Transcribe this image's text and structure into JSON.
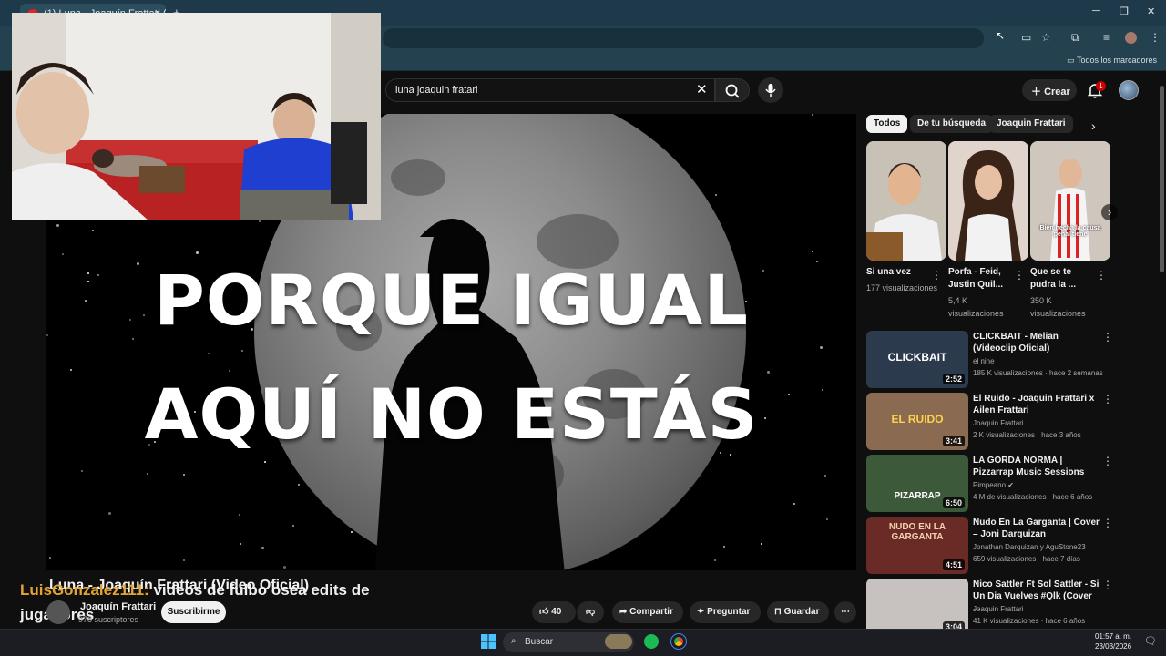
{
  "browser": {
    "tab_title": "(1) Luna - Joaquín Frattari (Vid",
    "tab_close": "×",
    "new_tab": "+",
    "bookmarks_label": "Todos los marcadores"
  },
  "masthead": {
    "search_query": "luna joaquin fratari",
    "create_label": "Crear",
    "notification_count": "1"
  },
  "player": {
    "lyric_line1": "PORQUE IGUAL",
    "lyric_line2": "AQUÍ NO ESTÁS"
  },
  "video": {
    "title": "Luna - Joaquín Frattari (Video Oficial)",
    "channel_name": "Joaquín Frattari",
    "subscribers": "978 suscriptores",
    "subscribe_label": "Suscribirme",
    "like_count": "40",
    "share_label": "Compartir",
    "ask_label": "Preguntar",
    "save_label": "Guardar"
  },
  "overlay_chat": {
    "user": "LuisGonzalez111:",
    "message": " videos de fulbo osea edits de jugadores"
  },
  "chips": [
    {
      "label": "Todos"
    },
    {
      "label": "De tu búsqueda"
    },
    {
      "label": "Joaquin Frattari"
    }
  ],
  "shorts": [
    {
      "title": "Si una vez",
      "views": "177 visualizaciones",
      "bg": "#c9b8a6"
    },
    {
      "title": "Porfa - Feid, Justin Quil...",
      "views": "5,4 K visualizaciones",
      "bg": "#d9c7be"
    },
    {
      "title": "Que se te pudra la ...",
      "views": "350 K visualizaciones",
      "bg": "#b3a8a0",
      "caption": "Bien hecha la causa penal tiene"
    }
  ],
  "related": [
    {
      "title": "CLICKBAIT - Melian (Videoclip Oficial)",
      "channel": "el nine",
      "meta": "185 K visualizaciones · hace 2 semanas",
      "duration": "2:52",
      "thumb_text": "CLICKBAIT",
      "bg": "#2b3a4c"
    },
    {
      "title": "El Ruido - Joaquin Frattari x Ailen Frattari",
      "channel": "Joaquin Frattari",
      "meta": "2 K visualizaciones · hace 3 años",
      "duration": "3:41",
      "thumb_text": "EL RUIDO",
      "bg": "#8a6b52"
    },
    {
      "title": "LA GORDA NORMA | Pizzarrap Music Sessions",
      "channel": "Pimpeano",
      "meta": "4 M de visualizaciones · hace 6 años",
      "duration": "6:50",
      "thumb_text": "PIZARRAP",
      "bg": "#3c5a3a"
    },
    {
      "title": "Nudo En La Garganta | Cover – Joni Darquizan",
      "channel": "Jonathan Darquizan y AguStone23",
      "meta": "659 visualizaciones · hace 7 días",
      "duration": "4:51",
      "thumb_text": "NUDO EN LA GARGANTA",
      "bg": "#6a2a26"
    },
    {
      "title": "Nico Sattler Ft Sol Sattler - Si Un Dia Vuelves #Qlk (Cover ...",
      "channel": "Joaquin Frattari",
      "meta": "41 K visualizaciones · hace 6 años",
      "duration": "3:04",
      "thumb_text": "",
      "bg": "#c7c2bf"
    }
  ],
  "taskbar": {
    "search_label": "Buscar",
    "time": "01:57 a. m.",
    "date": "23/03/2026"
  }
}
